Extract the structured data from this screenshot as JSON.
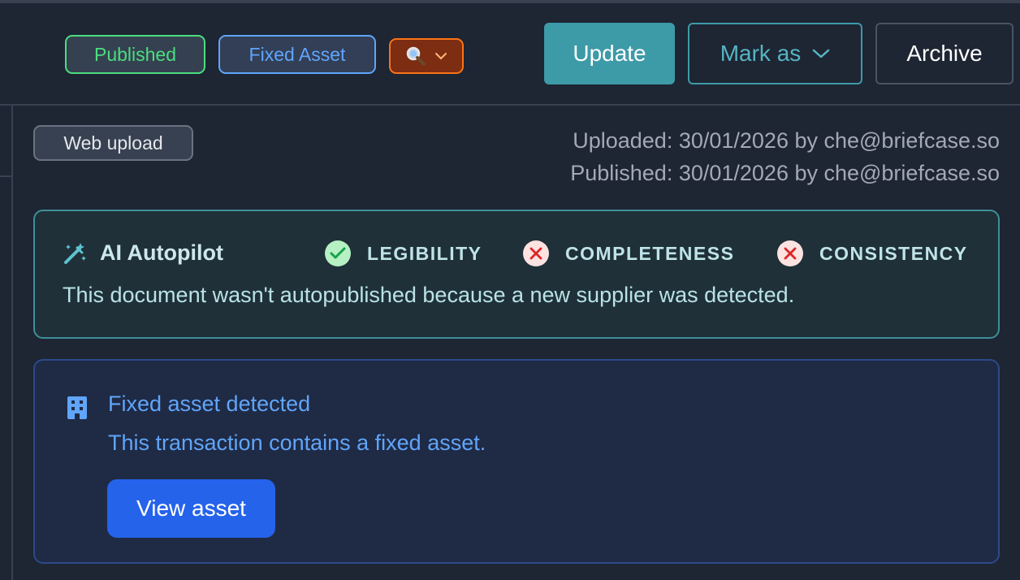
{
  "header": {
    "status_badge": "Published",
    "type_badge": "Fixed Asset",
    "search_badge_icon": "magnifier-icon",
    "update_label": "Update",
    "mark_as_label": "Mark as",
    "archive_label": "Archive"
  },
  "source": {
    "badge": "Web upload",
    "uploaded": "Uploaded: 30/01/2026 by che@briefcase.so",
    "published": "Published: 30/01/2026 by che@briefcase.so"
  },
  "autopilot": {
    "title": "AI Autopilot",
    "checks": [
      {
        "label": "LEGIBILITY",
        "status": "pass"
      },
      {
        "label": "COMPLETENESS",
        "status": "fail"
      },
      {
        "label": "CONSISTENCY",
        "status": "fail"
      }
    ],
    "message": "This document wasn't autopublished because a new supplier was detected."
  },
  "fixed_asset": {
    "title": "Fixed asset detected",
    "description": "This transaction contains a fixed asset.",
    "button_label": "View asset"
  },
  "colors": {
    "background": "#1e2533",
    "published_green": "#4ade80",
    "fixed_blue": "#60a5fa",
    "search_orange": "#f97316",
    "update_teal": "#3d9aa7",
    "primary_blue": "#2563eb"
  }
}
